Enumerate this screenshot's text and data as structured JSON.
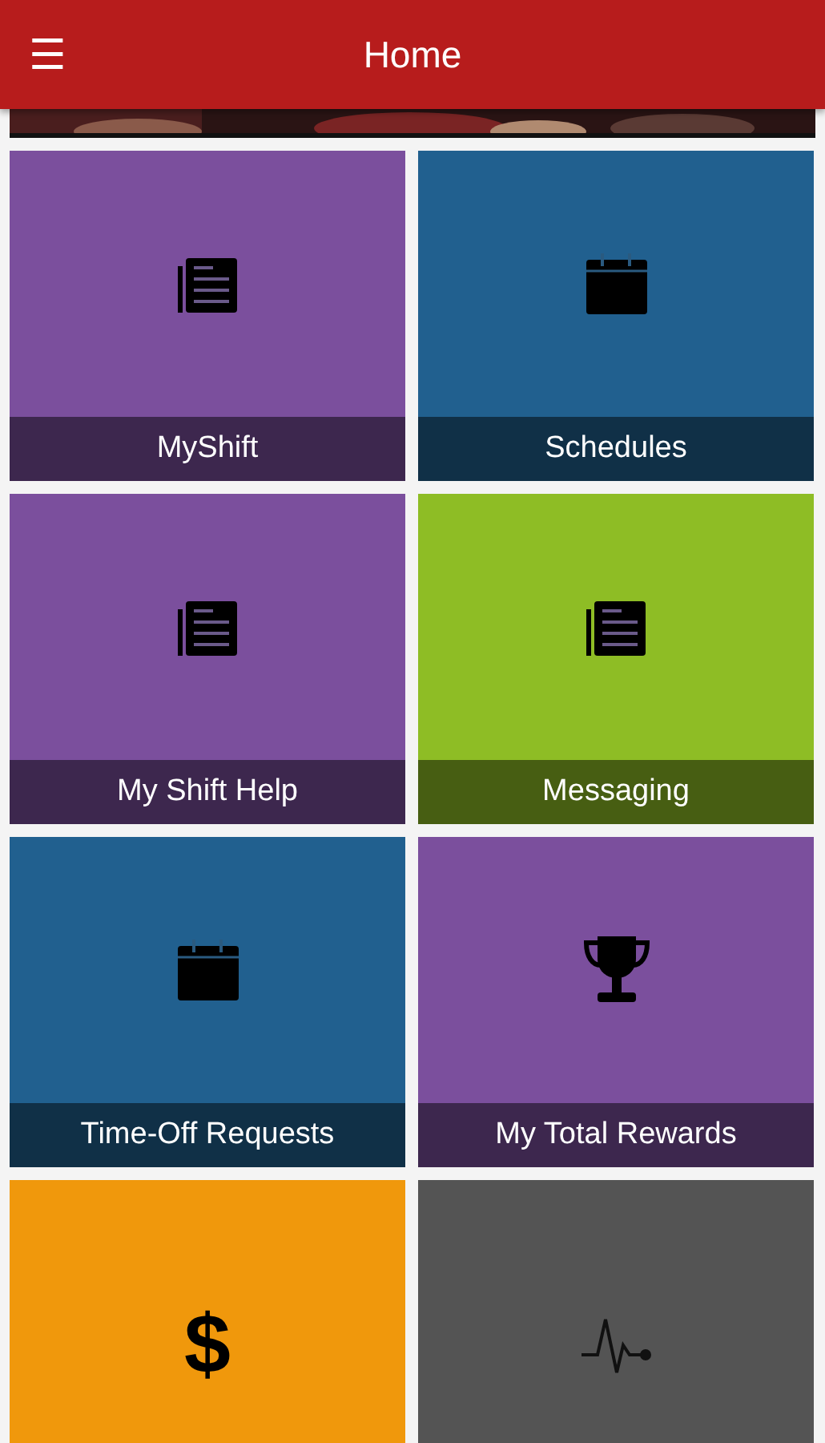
{
  "app_bar": {
    "title": "Home",
    "menu_icon": "☰"
  },
  "tiles": [
    {
      "label": "MyShift",
      "kind": "article",
      "color": "#7b4f9d"
    },
    {
      "label": "Schedules",
      "kind": "calendar",
      "color": "#21608f"
    },
    {
      "label": "My Shift Help",
      "kind": "article",
      "color": "#7b4f9d"
    },
    {
      "label": "Messaging",
      "kind": "article",
      "color": "#8ebd25"
    },
    {
      "label": "Time-Off Requests",
      "kind": "calendar",
      "color": "#21608f"
    },
    {
      "label": "My Total Rewards",
      "kind": "trophy",
      "color": "#7b4f9d"
    },
    {
      "kind": "glyph",
      "glyph": "$",
      "color": "#f0980c"
    },
    {
      "kind": "pulse",
      "color": "#545454"
    }
  ]
}
